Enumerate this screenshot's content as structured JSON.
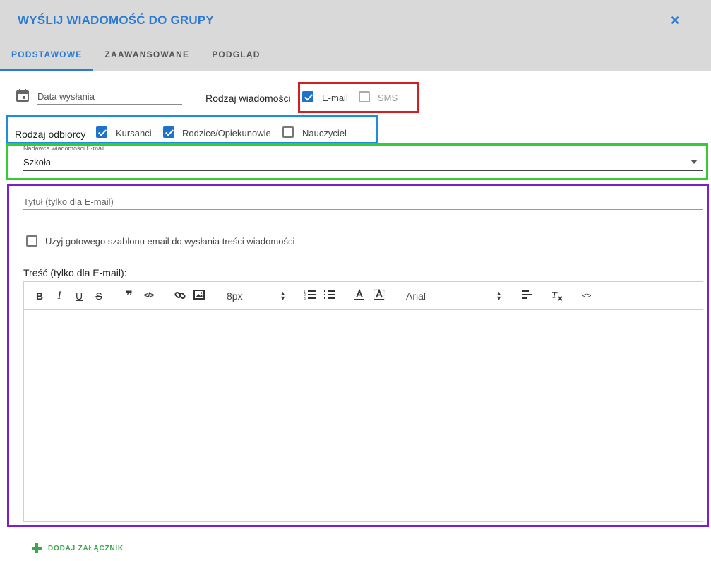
{
  "dialog": {
    "title": "WYŚLIJ WIADOMOŚĆ DO GRUPY",
    "close_icon": "×"
  },
  "tabs": [
    {
      "label": "PODSTAWOWE",
      "active": true
    },
    {
      "label": "ZAAWANSOWANE",
      "active": false
    },
    {
      "label": "PODGLĄD",
      "active": false
    }
  ],
  "date_field": {
    "placeholder": "Data wysłania",
    "value": ""
  },
  "message_type": {
    "label": "Rodzaj wiadomości",
    "options": [
      {
        "label": "E-mail",
        "checked": true
      },
      {
        "label": "SMS",
        "checked": false
      }
    ]
  },
  "recipient_type": {
    "label": "Rodzaj odbiorcy",
    "options": [
      {
        "label": "Kursanci",
        "checked": true
      },
      {
        "label": "Rodzice/Opiekunowie",
        "checked": true
      },
      {
        "label": "Nauczyciel",
        "checked": false
      }
    ]
  },
  "sender": {
    "caption": "Nadawca wiadomości E-mail",
    "value": "Szkoła"
  },
  "title_field": {
    "placeholder": "Tytuł (tylko dla E-mail)",
    "value": ""
  },
  "template_option": {
    "label": "Użyj gotowego szablonu email do wysłania treści wiadomości",
    "checked": false
  },
  "content": {
    "label": "Treść (tylko dla E-mail):",
    "toolbar": {
      "bold": "B",
      "italic": "I",
      "underline": "U",
      "strike": "S",
      "quote": "❞",
      "code": "</>",
      "font_size": "8px",
      "font_family": "Arial",
      "source": "<>"
    }
  },
  "attachment": {
    "label": "DODAJ ZAŁĄCZNIK"
  },
  "colors": {
    "accent": "#2a7bd6",
    "checkbox": "#1e73c9",
    "add": "#3aa84a"
  }
}
